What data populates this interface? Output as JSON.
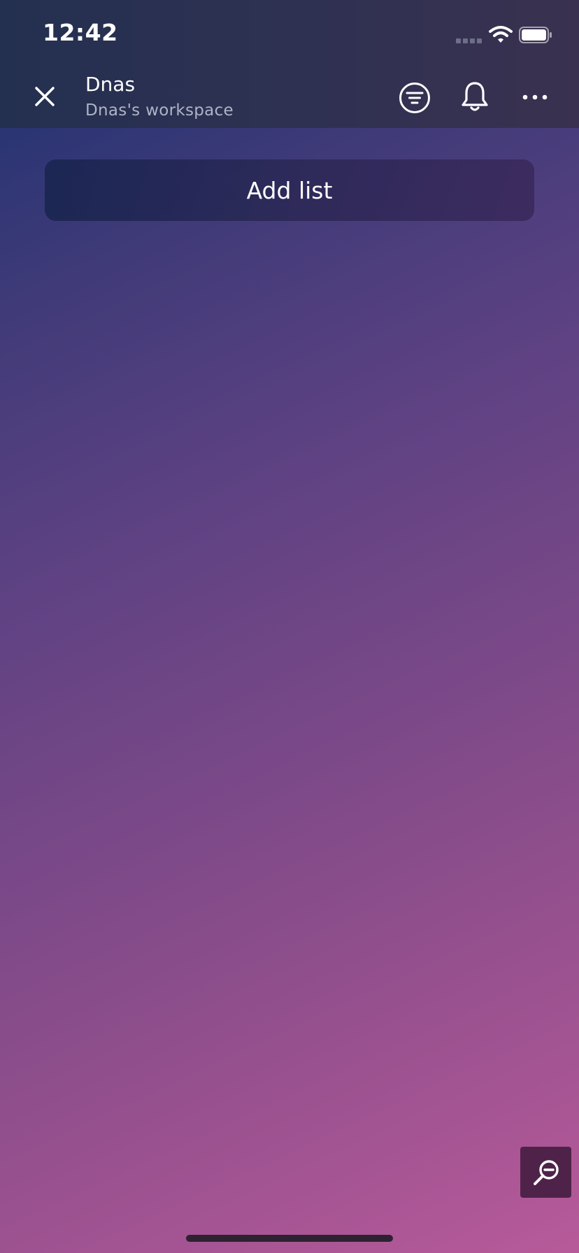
{
  "status_bar": {
    "time": "12:42",
    "icons": [
      "cellular-signal-icon",
      "wifi-icon",
      "battery-icon"
    ]
  },
  "header": {
    "close_icon": "close-icon",
    "title": "Dnas",
    "subtitle": "Dnas's workspace",
    "actions": [
      "filter-icon",
      "bell-icon",
      "more-icon"
    ]
  },
  "board": {
    "add_list_label": "Add list"
  },
  "zoom_control": {
    "icon": "zoom-out-icon"
  },
  "colors": {
    "gradient_start": "#1b3170",
    "gradient_end": "#b75a9a",
    "header_bg": "#2f3152",
    "zoom_button_bg": "#4f2349"
  }
}
